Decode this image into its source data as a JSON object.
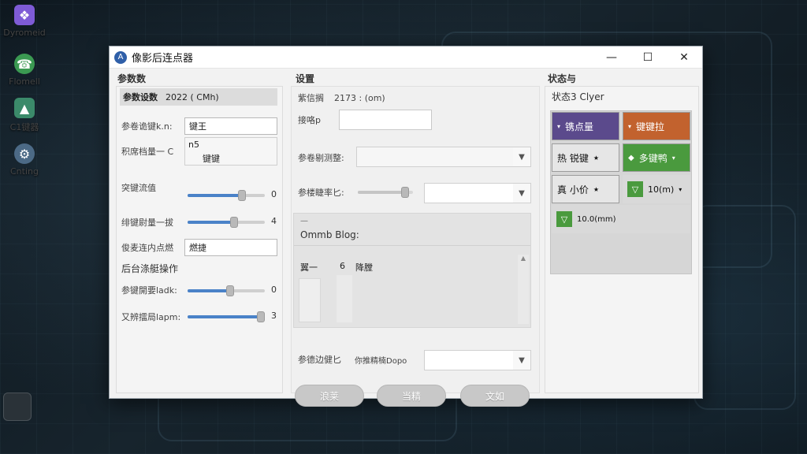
{
  "desktop": {
    "icons": [
      {
        "name": "Dyromeid",
        "glyph": "❖",
        "color": "#7e5bd6"
      },
      {
        "name": "Flomell",
        "glyph": "☎",
        "color": "#3b9a52"
      },
      {
        "name": "C1键器",
        "glyph": "▲",
        "color": "#3b8a6a"
      },
      {
        "name": "Cnting",
        "glyph": "⚙",
        "color": "#4c6a86"
      }
    ]
  },
  "window": {
    "title": "像影后连点器",
    "app_icon": "A",
    "controls": {
      "minimize": "—",
      "maximize": "☐",
      "close": "✕"
    }
  },
  "left": {
    "title": "参数数",
    "header_label": "参数设数",
    "header_value": "2022 ( CMh)",
    "field1_label": "参卷诡键k.n:",
    "field1_value": "键王",
    "field2_label": "积席档量一 C",
    "field2_value": "n5",
    "field2_sub": "键键",
    "slider1_label": "突键流值",
    "slider1_value": "0",
    "slider1_level": 0.7,
    "slider2_label": "绯键尉量一拔",
    "slider2_value": "4",
    "slider2_level": 0.6,
    "field3_label": "俊麦连内点燃",
    "field3_value": "燃捷",
    "section2_title": "后台涤艇操作",
    "slider3_label": "参键開要ladk:",
    "slider3_value": "0",
    "slider3_level": 0.55,
    "slider4_label": "又辨擂局lapm:",
    "slider4_value": "3",
    "slider4_level": 0.95
  },
  "middle": {
    "title": "设置",
    "row1_label": "紫信搁",
    "row1_value": "2173 : (om)",
    "row2_label": "接咯p",
    "row2_value": "",
    "dropdown1_label": "参卷剔测整:",
    "dropdown1_value": "",
    "dropdown2_label": "参楼睫率匕:",
    "dropdown2_value": "",
    "dropdown2_level": 0.85,
    "list_header": "—",
    "list_title": "Ommb Blog:",
    "list_col1": "翼一",
    "list_col2": "6",
    "list_col3": "降膛",
    "dropdown3_label": "参德边健匕",
    "dropdown3_hint": "你推精楠Dopo",
    "dropdown3_value": "",
    "buttons": [
      "浪莱",
      "当精",
      "文如"
    ]
  },
  "right": {
    "title": "状态与",
    "subtitle": "状态3 Clyer",
    "tiles": [
      {
        "label": "镌点量",
        "bg": "#5b4a8c",
        "fg": "#ffffff",
        "caret": "▾"
      },
      {
        "label": "键键拉",
        "bg": "#c2622e",
        "fg": "#ffffff",
        "caret": "▾"
      },
      {
        "label": "热 锐键",
        "bg": "#e6e6e6",
        "fg": "#111111",
        "caret": "★"
      },
      {
        "label": "多键鸭",
        "bg": "#4a9a3e",
        "fg": "#ffffff",
        "caret": "▾"
      },
      {
        "label": "真 小价",
        "bg": "#e6e6e6",
        "fg": "#111111",
        "caret": "★"
      },
      {
        "label": "10(m)",
        "bg": "#d9d9d9",
        "fg": "#111111",
        "caret": "▾"
      },
      {
        "label": "10.0(mm)",
        "bg": "#d9d9d9",
        "fg": "#111111",
        "caret": ""
      }
    ]
  }
}
